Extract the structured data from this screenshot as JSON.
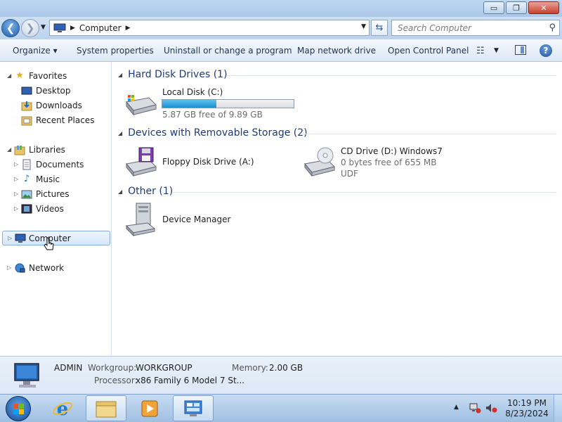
{
  "window": {
    "minimize_glyph": "▭",
    "restore_glyph": "❐",
    "close_glyph": "✕"
  },
  "address": {
    "location": "Computer",
    "search_placeholder": "Search Computer"
  },
  "commands": {
    "organize": "Organize ▾",
    "system_properties": "System properties",
    "uninstall": "Uninstall or change a program",
    "map_drive": "Map network drive",
    "open_control_panel": "Open Control Panel"
  },
  "nav": {
    "favorites": "Favorites",
    "desktop": "Desktop",
    "downloads": "Downloads",
    "recent_places": "Recent Places",
    "libraries": "Libraries",
    "documents": "Documents",
    "music": "Music",
    "pictures": "Pictures",
    "videos": "Videos",
    "computer": "Computer",
    "network": "Network"
  },
  "groups": {
    "hdd": {
      "title": "Hard Disk Drives (1)",
      "drives": [
        {
          "name": "Local Disk (C:)",
          "free": "5.87 GB free of 9.89 GB",
          "used_fraction": 0.41
        }
      ]
    },
    "removable": {
      "title": "Devices with Removable Storage (2)",
      "drives": [
        {
          "name": "Floppy Disk Drive (A:)"
        },
        {
          "name": "CD Drive (D:) Windows7",
          "free": "0 bytes free of 655 MB",
          "fs": "UDF"
        }
      ]
    },
    "other": {
      "title": "Other (1)",
      "items": [
        {
          "name": "Device Manager"
        }
      ]
    }
  },
  "details": {
    "computer_name": "ADMIN",
    "workgroup_label": "Workgroup:",
    "workgroup": "WORKGROUP",
    "memory_label": "Memory:",
    "memory": "2.00 GB",
    "processor_label": "Processor:",
    "processor": "x86 Family 6 Model 7 St..."
  },
  "taskbar": {
    "time": "10:19 PM",
    "date": "8/23/2024"
  },
  "colors": {
    "accent": "#1e3a78",
    "capacity_fill": "#1a8fd0",
    "selection": "#d5e6fa"
  }
}
